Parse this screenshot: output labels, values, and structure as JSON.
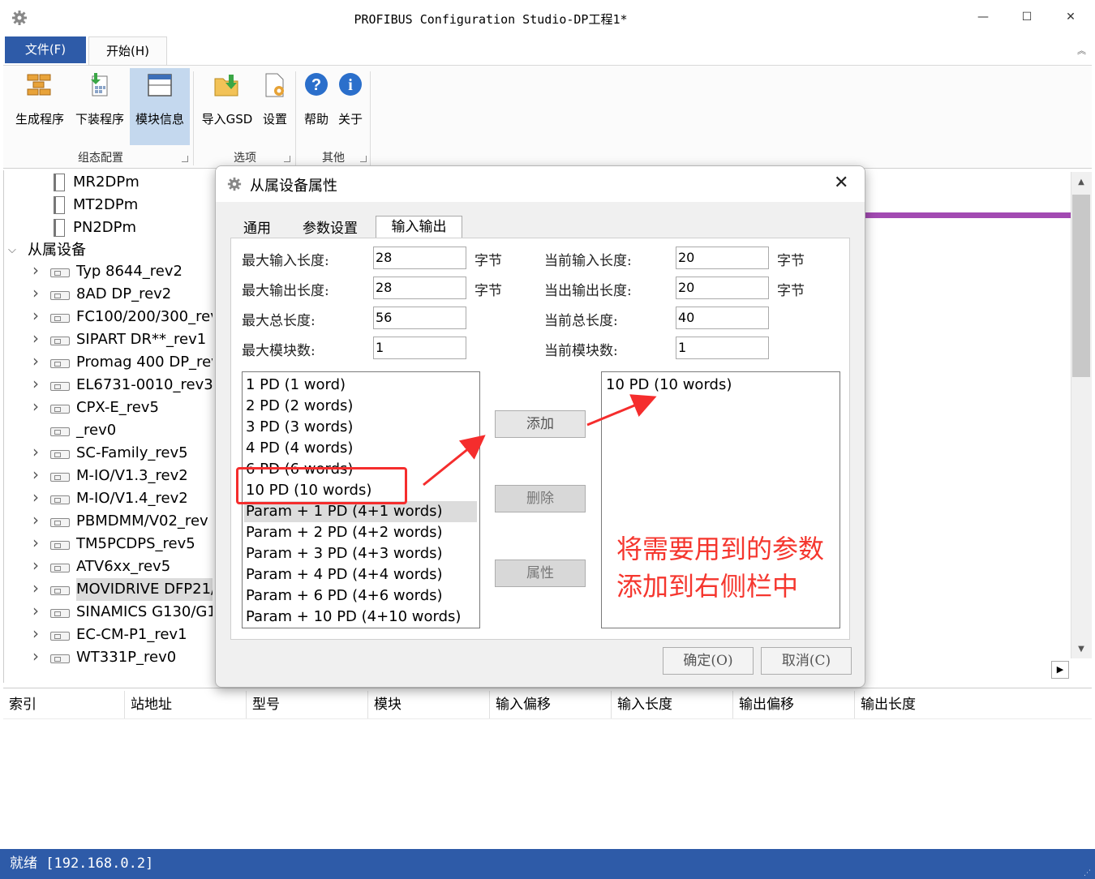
{
  "window": {
    "title": "PROFIBUS Configuration Studio-DP工程1*",
    "controls": [
      "—",
      "☐",
      "✕"
    ]
  },
  "ribbon": {
    "tabs": [
      "文件(F)",
      "开始(H)"
    ],
    "buttons": [
      "生成程序",
      "下装程序",
      "模块信息",
      "导入GSD",
      "设置",
      "帮助",
      "关于"
    ],
    "groups": [
      "组态配置",
      "选项",
      "其他"
    ]
  },
  "tree": {
    "items_top": [
      "MR2DPm",
      "MT2DPm",
      "PN2DPm"
    ],
    "section": "从属设备",
    "devices": [
      "Typ 8644_rev2",
      "8AD     DP_rev2",
      "FC100/200/300_rev",
      "SIPART DR**_rev1",
      "Promag 400 DP_rev",
      "EL6731-0010_rev3",
      "CPX-E_rev5",
      "_rev0",
      "SC-Family_rev5",
      "M-IO/V1.3_rev2",
      "M-IO/V1.4_rev2",
      "PBMDMM/V02_rev",
      "TM5PCDPS_rev5",
      "ATV6xx_rev5",
      "MOVIDRIVE DFP21/",
      "SINAMICS G130/G1",
      "EC-CM-P1_rev1",
      "WT331P_rev0"
    ]
  },
  "table": {
    "headers": [
      "索引",
      "站地址",
      "型号",
      "模块",
      "输入偏移",
      "输入长度",
      "输出偏移",
      "输出长度"
    ]
  },
  "status": {
    "text": "就绪 [192.168.0.2]"
  },
  "dialog": {
    "title": "从属设备属性",
    "tabs": [
      "通用",
      "参数设置",
      "输入输出"
    ],
    "left_fields": [
      {
        "label": "最大输入长度:",
        "value": "28",
        "unit": "字节"
      },
      {
        "label": "最大输出长度:",
        "value": "28",
        "unit": "字节"
      },
      {
        "label": "最大总长度:",
        "value": "56",
        "unit": ""
      },
      {
        "label": "最大模块数:",
        "value": "1",
        "unit": ""
      }
    ],
    "right_fields": [
      {
        "label": "当前输入长度:",
        "value": "20",
        "unit": "字节"
      },
      {
        "label": "当出输出长度:",
        "value": "20",
        "unit": "字节"
      },
      {
        "label": "当前总长度:",
        "value": "40",
        "unit": ""
      },
      {
        "label": "当前模块数:",
        "value": "1",
        "unit": ""
      }
    ],
    "available_modules": [
      "1 PD   (1 word)",
      "2 PD   (2 words)",
      "3 PD   (3 words)",
      "4 PD   (4 words)",
      "6 PD   (6 words)",
      "10 PD   (10 words)",
      "Param + 1 PD   (4+1 words)",
      "Param + 2 PD   (4+2 words)",
      "Param + 3 PD   (4+3 words)",
      "Param + 4 PD   (4+4 words)",
      "Param + 6 PD   (4+6 words)",
      "Param + 10 PD   (4+10 words)"
    ],
    "selected_modules": [
      "10 PD   (10 words)"
    ],
    "buttons": {
      "add": "添加",
      "delete": "删除",
      "properties": "属性",
      "ok": "确定(O)",
      "cancel": "取消(C)"
    }
  },
  "annotation": {
    "line1": "将需要用到的参数",
    "line2": "添加到右侧栏中",
    "color": "#f5362e"
  }
}
